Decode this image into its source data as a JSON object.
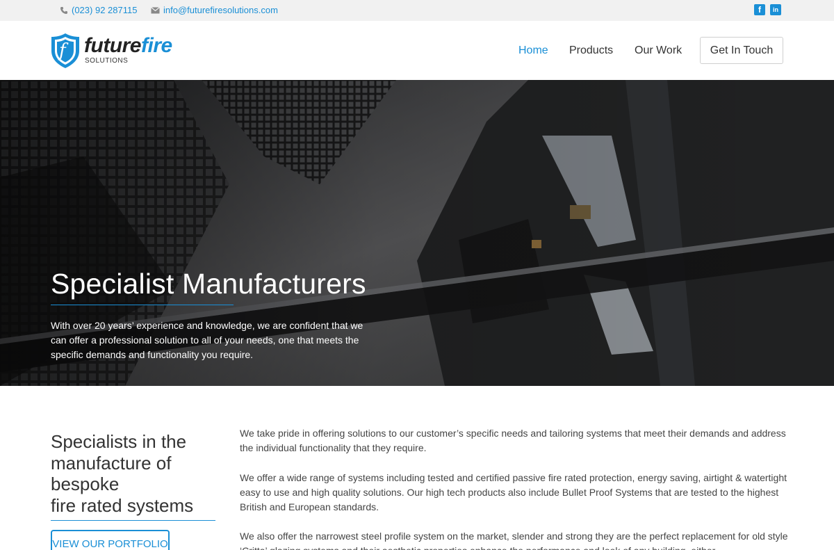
{
  "topbar": {
    "phone": "(023) 92 287115",
    "email": "info@futurefiresolutions.com",
    "social": [
      {
        "icon": "facebook-icon",
        "glyph": "f"
      },
      {
        "icon": "linkedin-icon",
        "glyph": "in"
      }
    ]
  },
  "logo": {
    "word_part1": "future",
    "word_part2": "fire",
    "sub": "SOLUTIONS",
    "mark": "f"
  },
  "nav": {
    "home": "Home",
    "products": "Products",
    "our_work": "Our Work",
    "cta": "Get In Touch",
    "active": "Home"
  },
  "hero": {
    "title": "Specialist Manufacturers",
    "text": "With over 20 years’ experience and knowledge, we are confident that we can offer a professional solution to all of your needs, one that meets the specific demands and functionality you require."
  },
  "intro": {
    "heading_lines": [
      "Specialists in the",
      "manufacture of",
      "bespoke",
      "fire rated systems"
    ],
    "button": "VIEW OUR PORTFOLIO",
    "paragraphs": [
      "We take pride in offering solutions to our customer’s specific needs and tailoring systems that meet their demands and address the individual functionality that they require.",
      "We offer a wide range of systems including tested and certified passive fire rated protection, energy saving, airtight & watertight easy to use and high quality solutions. Our high tech products also include Bullet Proof Systems that are tested to the highest British and European standards.",
      "We also offer the narrowest steel profile system on the market, slender and strong they are the perfect replacement for old style ‘Critta’ glazing systems and their aesthetic properties enhance the performance and look of any building, either"
    ]
  },
  "colors": {
    "accent": "#1a8fd6",
    "text": "#333333",
    "topbar_bg": "#f1f1f1"
  }
}
